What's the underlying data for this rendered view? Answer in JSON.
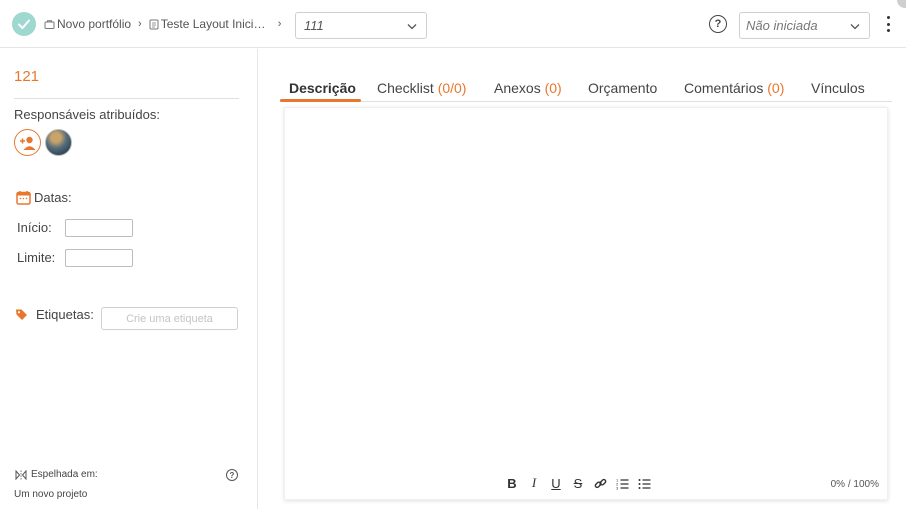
{
  "header": {
    "breadcrumb": [
      {
        "label": "Novo portfólio",
        "icon": "briefcase-icon"
      },
      {
        "label": "Teste Layout Iniciati...",
        "icon": "document-icon"
      }
    ],
    "task_select_value": "111",
    "status_select_value": "Não iniciada"
  },
  "sidebar": {
    "task_number": "121",
    "responsibles_label": "Responsáveis atribuídos:",
    "dates_label": "Datas:",
    "start_label": "Início:",
    "due_label": "Limite:",
    "tags_label": "Etiquetas:",
    "tag_placeholder": "Crie uma etiqueta",
    "mirrored_label": "Espelhada em:",
    "mirrored_project": "Um novo projeto"
  },
  "tabs": [
    {
      "label": "Descrição",
      "count": ""
    },
    {
      "label": "Checklist",
      "count": "(0/0)"
    },
    {
      "label": "Anexos",
      "count": "(0)"
    },
    {
      "label": "Orçamento",
      "count": ""
    },
    {
      "label": "Comentários",
      "count": "(0)"
    },
    {
      "label": "Vínculos",
      "count": ""
    }
  ],
  "editor": {
    "toolbar": [
      "B",
      "I",
      "U",
      "S",
      "link-icon",
      "ordered-list-icon",
      "bullet-list-icon"
    ],
    "progress": "0% / 100%"
  },
  "colors": {
    "accent": "#e8772e",
    "check_circle": "#9fd8cf"
  }
}
